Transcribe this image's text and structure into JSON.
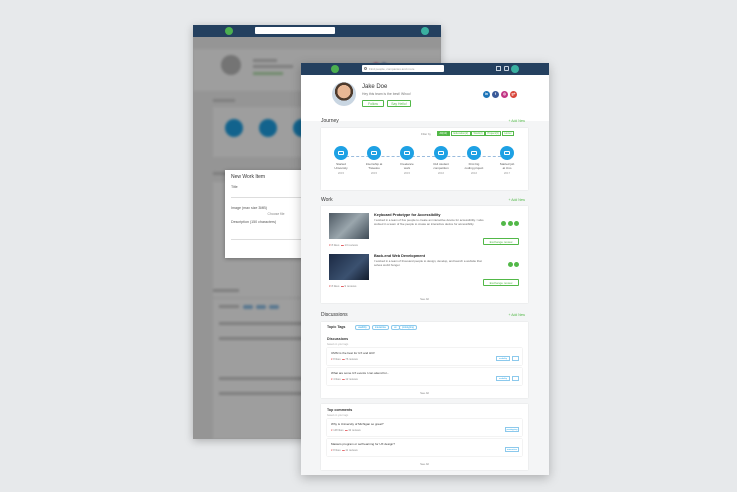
{
  "back_modal": {
    "title": "New Work Item",
    "title_label": "Title",
    "image_label": "Image (max size 3MB)",
    "choose_file": "Choose file",
    "description_label": "Description (150 characters)"
  },
  "topbar": {
    "search_placeholder": "Find people, companies and more"
  },
  "profile": {
    "name": "Jake Doe",
    "tagline": "Hey this team is the best! Whoo!",
    "follow": "Follow",
    "say_hello": "Say Hello!",
    "social": [
      {
        "name": "linkedin",
        "glyph": "in",
        "color": "#1e75b8"
      },
      {
        "name": "facebook",
        "glyph": "f",
        "color": "#3a5a98"
      },
      {
        "name": "instagram",
        "glyph": "◎",
        "color": "#c13584"
      },
      {
        "name": "google-plus",
        "glyph": "g+",
        "color": "#d8453a"
      }
    ]
  },
  "journey": {
    "title": "Journey",
    "add_new": "+ Add New",
    "filter_label": "Filter by",
    "filters": [
      "All(10)",
      "Education(2)",
      "Work(2)",
      "Project(3)",
      "Honor"
    ],
    "nodes": [
      {
        "label": "Started\nUniversity",
        "year": "2015"
      },
      {
        "label": "Internship at\nTraveloo",
        "year": "2015"
      },
      {
        "label": "Freelance\nwork",
        "year": "2015"
      },
      {
        "label": "CHI student\ncompetition",
        "year": "2016"
      },
      {
        "label": "First big\ncoding project",
        "year": "2016"
      },
      {
        "label": "Started job\nat Uno",
        "year": "2017"
      }
    ]
  },
  "work": {
    "title": "Work",
    "add_new": "+ Add New",
    "items": [
      {
        "title": "Keyboard Prototype for Accessibility",
        "desc": "I worked in a team of five people to create an interactive device for accessibility. I also worked in a team of five people to create an interactive device for accessibility.",
        "likes": "8 likes",
        "reviews": "13 reviews",
        "exchange": "Exchange review"
      },
      {
        "title": "Back-end Web Development",
        "desc": "I worked in a team of thousand people to design, develop, and launch a website that solves world hunger.",
        "likes": "8 likes",
        "reviews": "9 reviews",
        "exchange": "Exchange review"
      }
    ],
    "see_all": "See All"
  },
  "discussions": {
    "title": "Discussions",
    "add_new": "+ Add New",
    "topic_label": "Topic Tags",
    "tags": [
      "usability",
      "interactive",
      "ux",
      "prototyping"
    ],
    "sub": "Discussions",
    "note": "based on your tags",
    "items": [
      {
        "q": "UMSI is the best for UX and HCI!",
        "likes": "8 likes",
        "reviews": "76 reviews",
        "btn": "usability"
      },
      {
        "q": "What are some UX events I can attend for...",
        "likes": "4 likes",
        "reviews": "12 reviews",
        "btn": "usability"
      }
    ],
    "see_all": "See All"
  },
  "top_comments": {
    "title": "Top comments",
    "note": "based on your tags",
    "items": [
      {
        "q": "Why is University of Michigan so great?",
        "likes": "148 likes",
        "reviews": "32 reviews",
        "btn": "prototyping"
      },
      {
        "q": "Masters program or self learning for UX design?",
        "likes": "8 likes",
        "reviews": "11 reviews",
        "btn": "interactive"
      }
    ],
    "see_all": "See All"
  }
}
